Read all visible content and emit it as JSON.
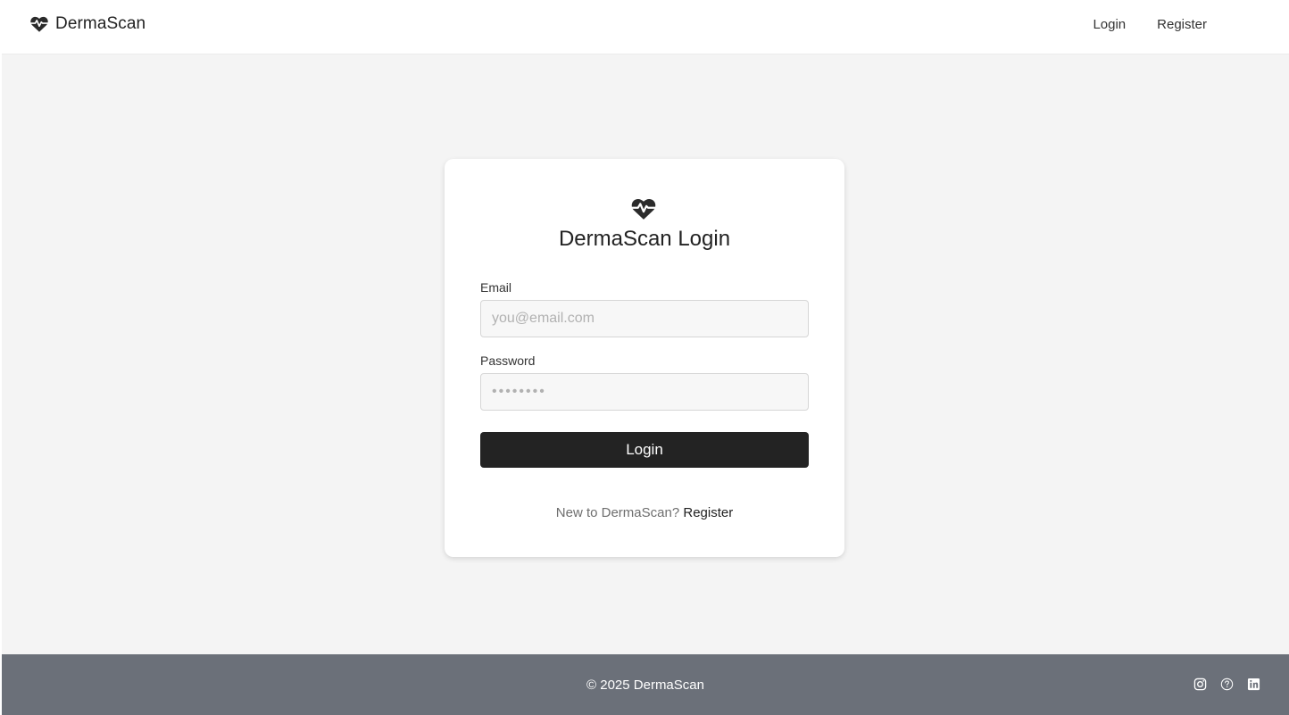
{
  "navbar": {
    "brand_icon": "heartbeat-icon",
    "brand_name": "DermaScan",
    "links": [
      {
        "label": "Login"
      },
      {
        "label": "Register"
      }
    ]
  },
  "login_card": {
    "icon": "heartbeat-icon",
    "title": "DermaScan Login",
    "email": {
      "label": "Email",
      "placeholder": "you@email.com",
      "value": ""
    },
    "password": {
      "label": "Password",
      "placeholder": "••••••••",
      "value": ""
    },
    "submit_label": "Login",
    "signup_prompt": "New to DermaScan?",
    "signup_link": "Register"
  },
  "footer": {
    "copyright": "© 2025 DermaScan",
    "social_icons": [
      "instagram-icon",
      "help-circle-icon",
      "linkedin-icon"
    ]
  },
  "colors": {
    "primary_button": "#232323",
    "page_background": "#f4f4f4",
    "footer_background": "#6b7079"
  }
}
